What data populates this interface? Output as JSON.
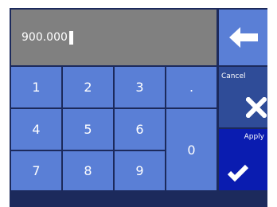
{
  "display": {
    "value": "900.000"
  },
  "keys": {
    "k1": "1",
    "k2": "2",
    "k3": "3",
    "dot": ".",
    "k4": "4",
    "k5": "5",
    "k6": "6",
    "k0": "0",
    "k7": "7",
    "k8": "8",
    "k9": "9"
  },
  "actions": {
    "backspace_icon": "arrow-left-icon",
    "cancel_label": "Cancel",
    "cancel_icon": "close-icon",
    "apply_label": "Apply",
    "apply_icon": "checkmark-icon"
  },
  "colors": {
    "key": "#5a7fd6",
    "display": "#808080",
    "cancel": "#2f4c98",
    "apply": "#0a1cb0",
    "frame": "#1c2a5c"
  }
}
